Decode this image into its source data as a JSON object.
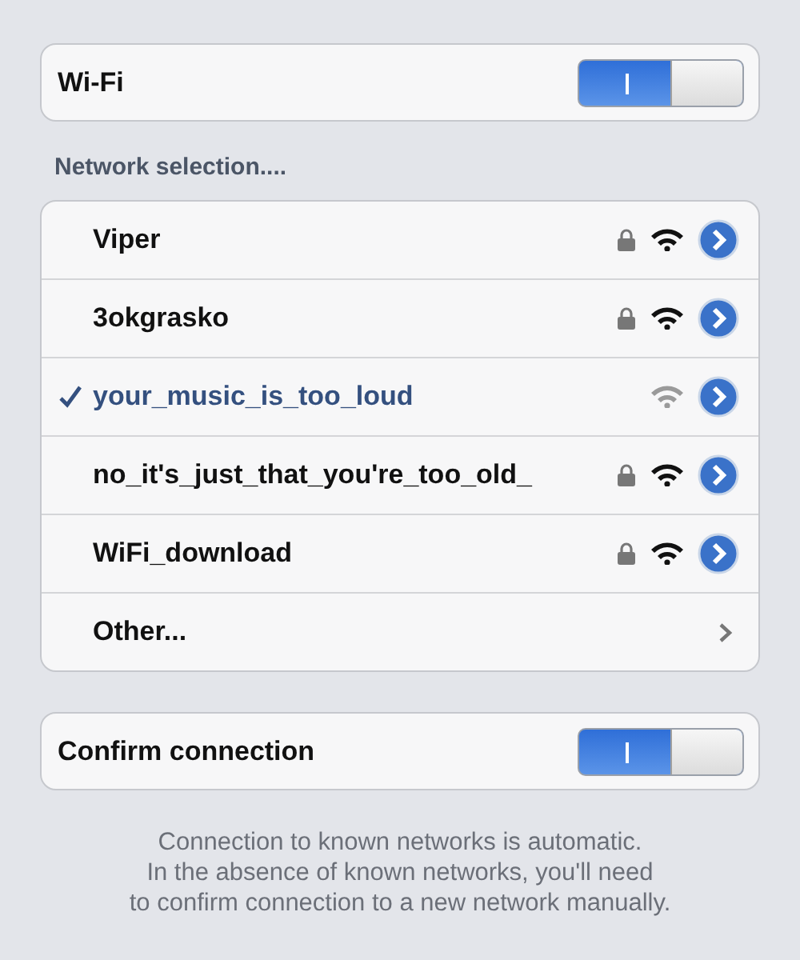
{
  "wifi": {
    "label": "Wi-Fi",
    "on": true
  },
  "section_header": "Network selection....",
  "networks": [
    {
      "kind": "network",
      "name": "Viper",
      "selected": false,
      "locked": true
    },
    {
      "kind": "network",
      "name": "3okgrasko",
      "selected": false,
      "locked": true
    },
    {
      "kind": "network",
      "name": "your_music_is_too_loud",
      "selected": true,
      "locked": false
    },
    {
      "kind": "network",
      "name": "no_it's_just_that_you're_too_old_",
      "selected": false,
      "locked": true
    },
    {
      "kind": "network",
      "name": "WiFi_download",
      "selected": false,
      "locked": true
    },
    {
      "kind": "other",
      "name": "Other...",
      "selected": false
    }
  ],
  "confirm": {
    "label": "Confirm connection",
    "on": true
  },
  "footer_lines": [
    "Connection to known networks is automatic.",
    "In the absence of known networks, you'll need",
    "to confirm connection to a new network manually."
  ]
}
